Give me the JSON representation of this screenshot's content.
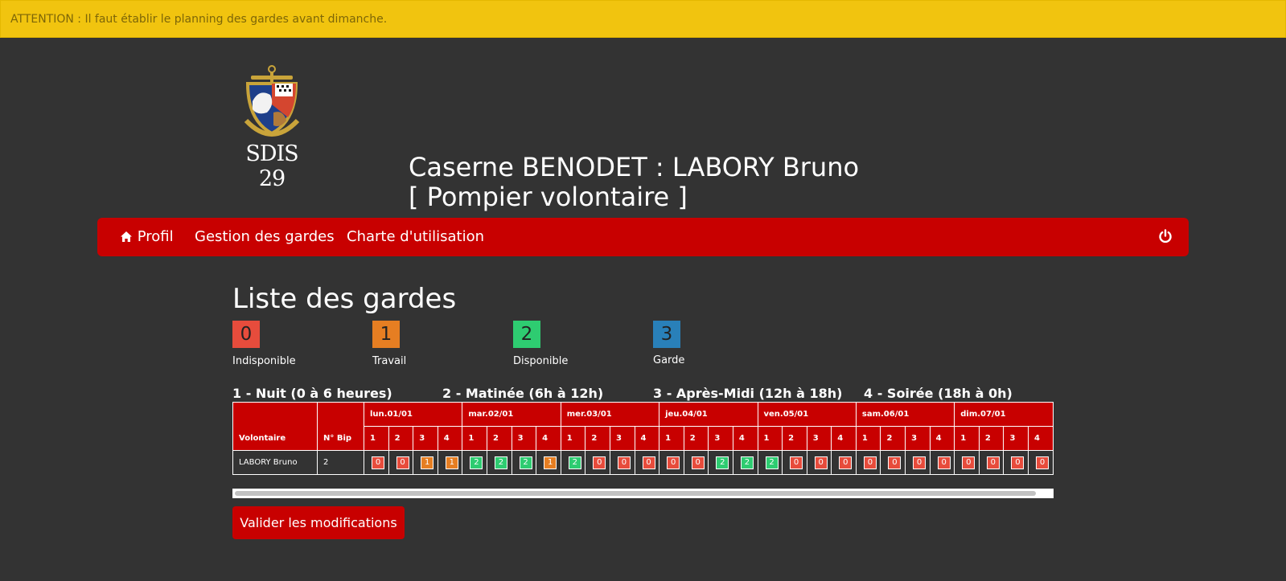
{
  "alert": {
    "text": "ATTENTION : Il faut établir le planning des gardes avant dimanche."
  },
  "logo": {
    "text": "SDIS 29",
    "icon": "sdis29-crest"
  },
  "header": {
    "line1": "Caserne BENODET : LABORY Bruno",
    "line2": "[ Pompier volontaire ]"
  },
  "nav": {
    "items": [
      {
        "label": "Profil",
        "icon": "home-icon"
      },
      {
        "label": "Gestion des gardes"
      },
      {
        "label": "Charte d'utilisation"
      }
    ],
    "logout_icon": "power-icon"
  },
  "page_title": "Liste des gardes",
  "legend": [
    {
      "value": "0",
      "label": "Indisponible",
      "color": "#e74c3c"
    },
    {
      "value": "1",
      "label": "Travail",
      "color": "#e67e22"
    },
    {
      "value": "2",
      "label": "Disponible",
      "color": "#2ecc71"
    },
    {
      "value": "3",
      "label": "Garde",
      "color": "#2980b9"
    }
  ],
  "periods": [
    "1 - Nuit (0 à 6 heures)",
    "2 - Matinée (6h à 12h)",
    "3 - Après-Midi (12h à 18h)",
    "4 - Soirée (18h à 0h)"
  ],
  "table": {
    "col_volontaire": "Volontaire",
    "col_bip": "N° Bip",
    "days": [
      "lun.01/01",
      "mar.02/01",
      "mer.03/01",
      "jeu.04/01",
      "ven.05/01",
      "sam.06/01",
      "dim.07/01"
    ],
    "slots": [
      "1",
      "2",
      "3",
      "4"
    ],
    "rows": [
      {
        "name": "LABORY Bruno",
        "bip": "2",
        "values": [
          [
            0,
            0,
            1,
            1
          ],
          [
            2,
            2,
            2,
            1
          ],
          [
            2,
            0,
            0,
            0
          ],
          [
            0,
            0,
            2,
            2
          ],
          [
            2,
            0,
            0,
            0
          ],
          [
            0,
            0,
            0,
            0
          ],
          [
            0,
            0,
            0,
            0
          ]
        ]
      }
    ]
  },
  "status_colors": {
    "0": "#e74c3c",
    "1": "#e67e22",
    "2": "#2ecc71",
    "3": "#2980b9"
  },
  "submit_label": "Valider les modifications"
}
